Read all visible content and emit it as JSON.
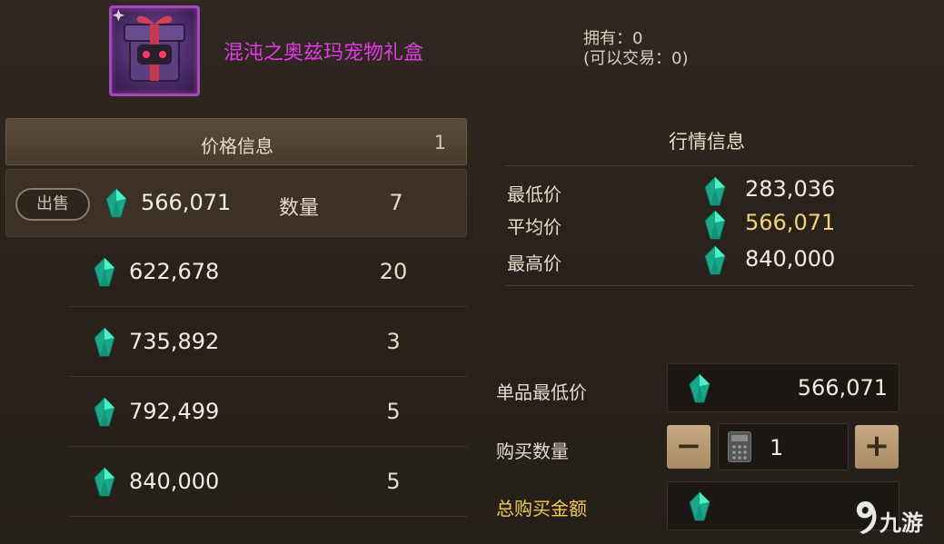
{
  "item": {
    "name": "混沌之奥兹玛宠物礼盒",
    "owned": "拥有：0",
    "tradable": "(可以交易：0)"
  },
  "price_panel": {
    "title": "价格信息",
    "page": "1",
    "sell_label": "出售",
    "qty_label": "数量",
    "rows": [
      {
        "price": "566,071",
        "qty": "7"
      },
      {
        "price": "622,678",
        "qty": "20"
      },
      {
        "price": "735,892",
        "qty": "3"
      },
      {
        "price": "792,499",
        "qty": "5"
      },
      {
        "price": "840,000",
        "qty": "5"
      }
    ]
  },
  "market": {
    "title": "行情信息",
    "min_label": "最低价",
    "min_value": "283,036",
    "avg_label": "平均价",
    "avg_value": "566,071",
    "max_label": "最高价",
    "max_value": "840,000"
  },
  "purchase": {
    "unit_min_label": "单品最低价",
    "unit_min_value": "566,071",
    "qty_label": "购买数量",
    "qty_value": "1",
    "minus": "−",
    "plus": "+",
    "total_label": "总购买金额",
    "total_value": ""
  },
  "watermark": {
    "text": "九游"
  },
  "colors": {
    "item_name": "#e03be6",
    "avg_value": "#f3d27a",
    "total_label": "#f3c858",
    "gem": "#2fd6b0"
  }
}
